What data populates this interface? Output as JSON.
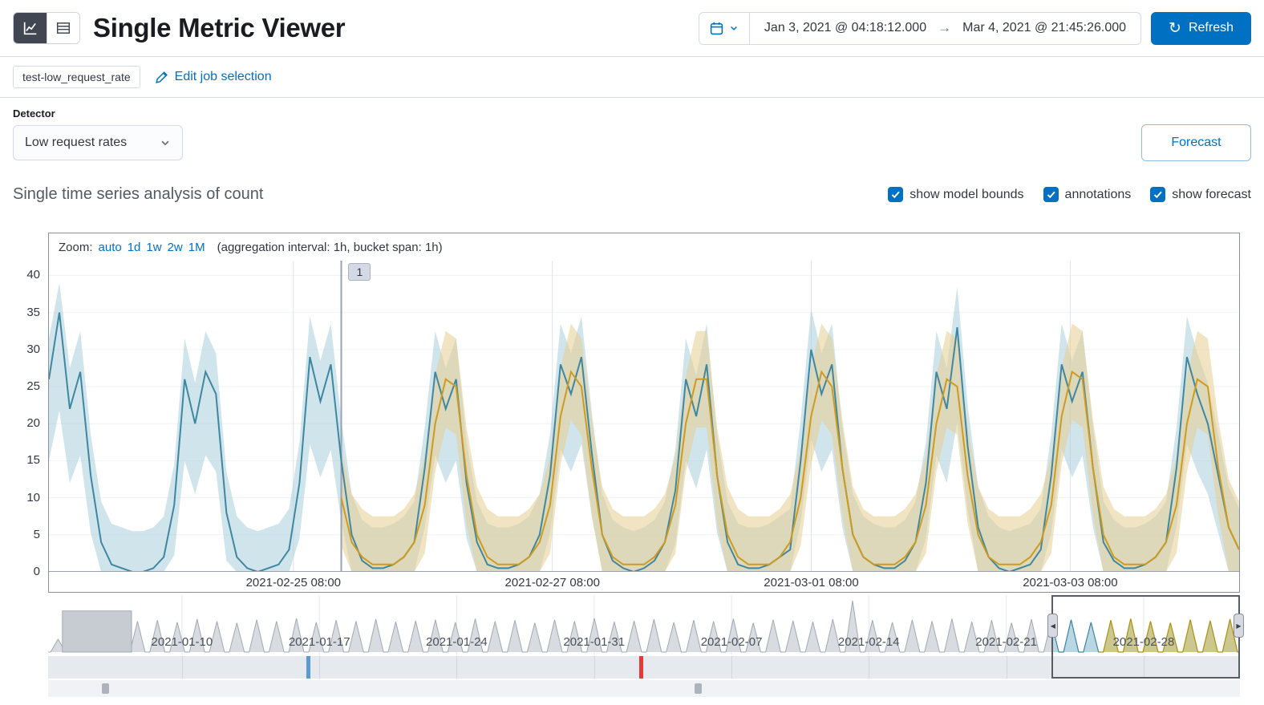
{
  "header": {
    "title": "Single Metric Viewer",
    "refresh": "Refresh",
    "datepicker": {
      "start": "Jan 3, 2021 @ 04:18:12.000",
      "arrow": "→",
      "end": "Mar 4, 2021 @ 21:45:26.000"
    }
  },
  "jobs": {
    "badge": "test-low_request_rate",
    "edit_link": "Edit job selection"
  },
  "detector": {
    "label": "Detector",
    "value": "Low request rates"
  },
  "actions": {
    "forecast": "Forecast"
  },
  "series_header": {
    "title": "Single time series analysis of count",
    "toggles": [
      {
        "label": "show model bounds",
        "checked": true
      },
      {
        "label": "annotations",
        "checked": true
      },
      {
        "label": "show forecast",
        "checked": true
      }
    ]
  },
  "zoom": {
    "label": "Zoom:",
    "links": [
      "auto",
      "1d",
      "1w",
      "2w",
      "1M"
    ],
    "info": "(aggregation interval: 1h, bucket span: 1h)"
  },
  "icons": [
    "line-chart-icon",
    "table-icon",
    "calendar-icon",
    "chevron-down-icon",
    "refresh-icon",
    "pencil-icon",
    "arrow-right-icon",
    "checkbox-check-icon",
    "brush-handle-left-icon",
    "brush-handle-right-icon"
  ],
  "theme": {
    "primary": "#0071c2",
    "text": "#343741",
    "border": "#d3dae6"
  },
  "chart_data": [
    {
      "id": "main",
      "type": "line",
      "title": "Single time series analysis of count",
      "ylabel": "count",
      "ylim": [
        0,
        42
      ],
      "yticks": [
        0,
        5,
        10,
        15,
        20,
        25,
        30,
        35,
        40
      ],
      "total_hours": 228,
      "xticks": [
        {
          "label": "2021-02-25 08:00",
          "frac": 0.2054
        },
        {
          "label": "2021-02-27 08:00",
          "frac": 0.423
        },
        {
          "label": "2021-03-01 08:00",
          "frac": 0.6405
        },
        {
          "label": "2021-03-03 08:00",
          "frac": 0.8581
        }
      ],
      "annotation": {
        "label": "1"
      },
      "forecast_start_hour": 56,
      "model_bounds": {
        "upper_mul": 1.0,
        "upper_add": 5.5,
        "lower_mul": 0.75,
        "lower_add": -4.5,
        "cap": 39
      },
      "forecast_bounds": {
        "pad": 6.5
      },
      "series": [
        {
          "name": "actual",
          "color": "#3f87a1",
          "band_color": "#a9cedd",
          "start_hour": 0,
          "step_hours": 2,
          "values": [
            26,
            35,
            22,
            27,
            13,
            4,
            1,
            0.5,
            0,
            0,
            0.5,
            2,
            9,
            26,
            20,
            27,
            24,
            8,
            2,
            0.5,
            0,
            0.5,
            1,
            3,
            12,
            29,
            23,
            28,
            15,
            5,
            1.5,
            0.5,
            0.5,
            1,
            2,
            4,
            14,
            27,
            22,
            26,
            12,
            4,
            1,
            0.5,
            0.5,
            1,
            2,
            5,
            13,
            28,
            24,
            29,
            16,
            5,
            1.5,
            0.5,
            0,
            0.5,
            1.5,
            4,
            11,
            26,
            21,
            28,
            13,
            4,
            1,
            0.5,
            0.5,
            1,
            2,
            3,
            15,
            30,
            24,
            28,
            14,
            5,
            2,
            1,
            0.5,
            0.5,
            1.5,
            4,
            12,
            27,
            22,
            33,
            17,
            6,
            2,
            0.5,
            0,
            0.5,
            1,
            3,
            13,
            28,
            23,
            27,
            14,
            4,
            1.5,
            0.5,
            0.5,
            1,
            2,
            4,
            14,
            29,
            24,
            20,
            13,
            6,
            3
          ]
        },
        {
          "name": "forecast",
          "color": "#ce9b20",
          "band_color": "#e6cd90",
          "start_hour": 56,
          "step_hours": 2,
          "values": [
            10,
            4,
            2,
            1,
            1,
            1,
            2,
            4,
            9,
            20,
            26,
            25,
            13,
            5,
            2,
            1,
            1,
            1,
            2,
            4,
            9,
            21,
            27,
            25,
            14,
            5,
            2,
            1,
            1,
            1,
            2,
            4,
            9,
            20,
            26,
            26,
            13,
            5,
            2,
            1,
            1,
            1,
            2,
            4,
            10,
            21,
            27,
            25,
            14,
            5,
            2,
            1,
            1,
            1,
            2,
            4,
            9,
            20,
            26,
            25,
            13,
            5,
            2,
            1,
            1,
            1,
            2,
            4,
            9,
            21,
            27,
            26,
            14,
            5,
            2,
            1,
            1,
            1,
            2,
            4,
            9,
            20,
            26,
            25,
            14,
            6,
            3
          ]
        }
      ]
    },
    {
      "id": "context",
      "type": "area",
      "days": 60,
      "xticks": [
        {
          "label": "2021-01-10",
          "frac": 0.1123
        },
        {
          "label": "2021-01-17",
          "frac": 0.2276
        },
        {
          "label": "2021-01-24",
          "frac": 0.3428
        },
        {
          "label": "2021-01-31",
          "frac": 0.4581
        },
        {
          "label": "2021-02-07",
          "frac": 0.5734
        },
        {
          "label": "2021-02-14",
          "frac": 0.6886
        },
        {
          "label": "2021-02-21",
          "frac": 0.8039
        },
        {
          "label": "2021-02-28",
          "frac": 0.9192
        }
      ],
      "peak_heights": [
        0.25,
        0.3,
        0.3,
        0.55,
        0.6,
        0.62,
        0.58,
        0.64,
        0.6,
        0.57,
        0.63,
        0.6,
        0.66,
        0.58,
        0.62,
        0.6,
        0.64,
        0.59,
        0.61,
        0.63,
        0.58,
        0.65,
        0.6,
        0.62,
        0.57,
        0.63,
        0.6,
        0.66,
        0.59,
        0.61,
        0.64,
        0.58,
        0.62,
        0.6,
        0.65,
        0.57,
        0.63,
        0.61,
        0.59,
        0.64,
        1.0,
        0.62,
        0.58,
        0.63,
        0.6,
        0.65,
        0.59,
        0.62,
        0.57,
        0.64,
        0.6,
        0.63,
        0.58,
        0.62,
        0.65,
        0.6,
        0.57,
        0.63,
        0.61,
        0.64
      ],
      "plateau": {
        "start_frac": 0.012,
        "end_frac": 0.07,
        "height": 0.8
      },
      "selection": {
        "start_frac": 0.8421,
        "end_frac": 1.0,
        "forecast_frac": 0.8814
      },
      "anomaly_markers": [
        {
          "frac": 0.218,
          "color": "#5b9bd5"
        },
        {
          "frac": 0.497,
          "color": "#e53935"
        }
      ],
      "bottom_markers": [
        {
          "frac": 0.048
        },
        {
          "frac": 0.545
        }
      ]
    }
  ]
}
